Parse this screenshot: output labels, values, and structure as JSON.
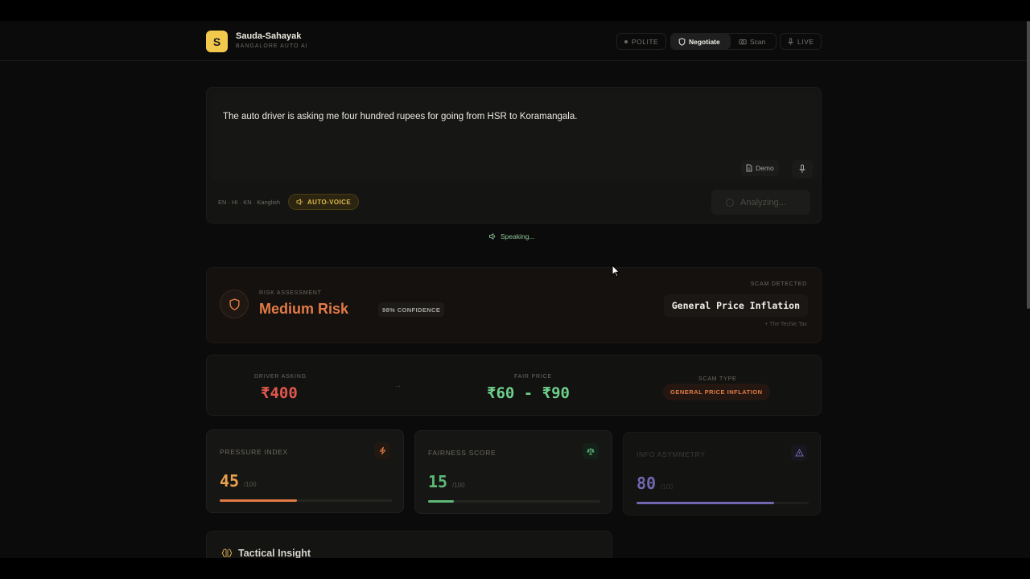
{
  "brand": {
    "logo_letter": "S",
    "name": "Sauda-Sahayak",
    "subtitle": "BANGALORE AUTO AI"
  },
  "nav": {
    "polite": "POLITE",
    "negotiate": "Negotiate",
    "scan": "Scan",
    "live": "LIVE",
    "active": "Negotiate"
  },
  "input": {
    "query": "The auto driver is asking me four hundred rupees for going from HSR to Koramangala.",
    "demo_label": "Demo",
    "languages": "EN · HI · KN · Kanglish",
    "auto_voice": "AUTO-VOICE",
    "analyze_label": "Analyzing...",
    "status": "Speaking..."
  },
  "risk": {
    "label": "RISK ASSESSMENT",
    "level": "Medium Risk",
    "confidence": "98% CONFIDENCE",
    "scam_label": "SCAM DETECTED",
    "scam_name": "General Price Inflation",
    "scam_sub": "+ The Techie Tax"
  },
  "price": {
    "asking_label": "DRIVER ASKING",
    "asking_value": "₹400",
    "fair_label": "FAIR PRICE",
    "fair_value": "₹60 - ₹90",
    "type_label": "SCAM TYPE",
    "type_value": "GENERAL PRICE INFLATION",
    "arrow": "→"
  },
  "metrics": [
    {
      "label": "PRESSURE INDEX",
      "value": "45",
      "max": "/100",
      "level": 0.45,
      "color": "#e47b46",
      "icon": "lightning-icon"
    },
    {
      "label": "FAIRNESS SCORE",
      "value": "15",
      "max": "/100",
      "level": 0.15,
      "color": "#5fb878",
      "icon": "scale-icon"
    },
    {
      "label": "INFO ASYMMETRY",
      "value": "80",
      "max": "/100",
      "level": 0.8,
      "color": "#8b7fd8",
      "icon": "warning-icon"
    }
  ],
  "insight": {
    "title": "Tactical Insight",
    "icon": "brain-icon"
  },
  "colors": {
    "accent": "#f2c94c",
    "risk": "#e47b46",
    "asking": "#e2574c",
    "fair": "#6fcf8a",
    "asymmetry": "#8b7fd8"
  }
}
